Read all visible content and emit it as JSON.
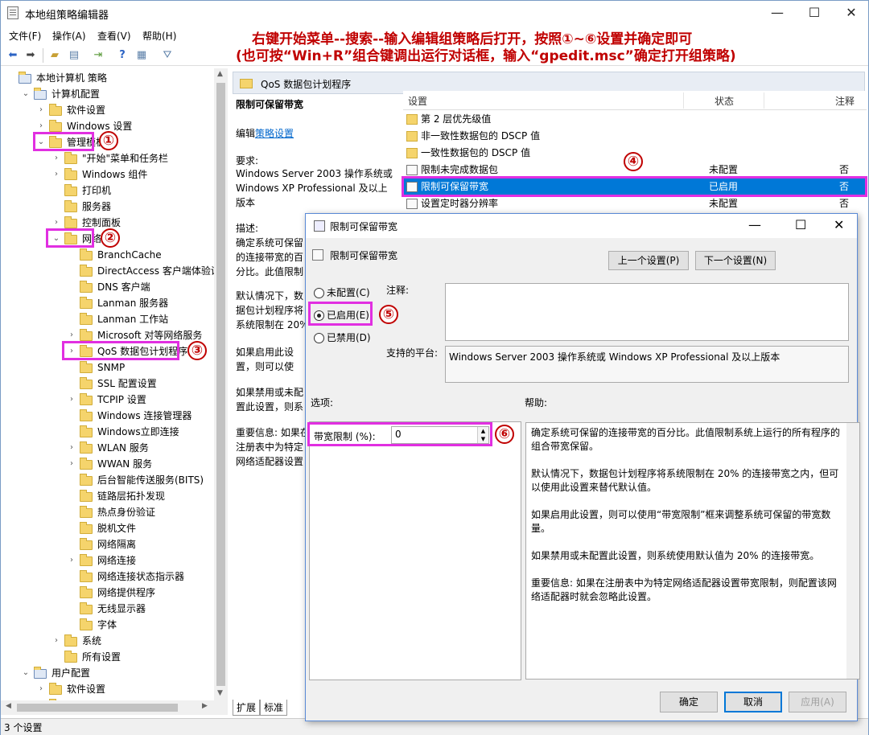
{
  "window": {
    "title": "本地组策略编辑器",
    "min": "—",
    "max": "☐",
    "close": "✕"
  },
  "menu": [
    "文件(F)",
    "操作(A)",
    "查看(V)",
    "帮助(H)"
  ],
  "instruction": {
    "line1": "右键开始菜单--搜索--输入编辑组策略后打开，按照①~⑥设置并确定即可",
    "line2": "(也可按“Win+R”组合键调出运行对话框，输入“gpedit.msc”确定打开组策略)"
  },
  "tree": [
    {
      "label": "本地计算机 策略",
      "indent": 0,
      "exp": "",
      "icon": "computer"
    },
    {
      "label": "计算机配置",
      "indent": 1,
      "exp": "⌄",
      "icon": "computer"
    },
    {
      "label": "软件设置",
      "indent": 2,
      "exp": "›",
      "icon": "folder"
    },
    {
      "label": "Windows 设置",
      "indent": 2,
      "exp": "›",
      "icon": "folder"
    },
    {
      "label": "管理模板",
      "indent": 2,
      "exp": "⌄",
      "icon": "folder"
    },
    {
      "label": "\"开始\"菜单和任务栏",
      "indent": 3,
      "exp": "›",
      "icon": "folder"
    },
    {
      "label": "Windows 组件",
      "indent": 3,
      "exp": "›",
      "icon": "folder"
    },
    {
      "label": "打印机",
      "indent": 3,
      "exp": "",
      "icon": "folder"
    },
    {
      "label": "服务器",
      "indent": 3,
      "exp": "",
      "icon": "folder"
    },
    {
      "label": "控制面板",
      "indent": 3,
      "exp": "›",
      "icon": "folder"
    },
    {
      "label": "网络",
      "indent": 3,
      "exp": "⌄",
      "icon": "folder"
    },
    {
      "label": "BranchCache",
      "indent": 4,
      "exp": "",
      "icon": "folder"
    },
    {
      "label": "DirectAccess 客户端体验设置",
      "indent": 4,
      "exp": "",
      "icon": "folder"
    },
    {
      "label": "DNS 客户端",
      "indent": 4,
      "exp": "",
      "icon": "folder"
    },
    {
      "label": "Lanman 服务器",
      "indent": 4,
      "exp": "",
      "icon": "folder"
    },
    {
      "label": "Lanman 工作站",
      "indent": 4,
      "exp": "",
      "icon": "folder"
    },
    {
      "label": "Microsoft 对等网络服务",
      "indent": 4,
      "exp": "›",
      "icon": "folder"
    },
    {
      "label": "QoS 数据包计划程序",
      "indent": 4,
      "exp": "›",
      "icon": "folder"
    },
    {
      "label": "SNMP",
      "indent": 4,
      "exp": "",
      "icon": "folder"
    },
    {
      "label": "SSL 配置设置",
      "indent": 4,
      "exp": "",
      "icon": "folder"
    },
    {
      "label": "TCPIP 设置",
      "indent": 4,
      "exp": "›",
      "icon": "folder"
    },
    {
      "label": "Windows 连接管理器",
      "indent": 4,
      "exp": "",
      "icon": "folder"
    },
    {
      "label": "Windows立即连接",
      "indent": 4,
      "exp": "",
      "icon": "folder"
    },
    {
      "label": "WLAN 服务",
      "indent": 4,
      "exp": "›",
      "icon": "folder"
    },
    {
      "label": "WWAN 服务",
      "indent": 4,
      "exp": "›",
      "icon": "folder"
    },
    {
      "label": "后台智能传送服务(BITS)",
      "indent": 4,
      "exp": "",
      "icon": "folder"
    },
    {
      "label": "链路层拓扑发现",
      "indent": 4,
      "exp": "",
      "icon": "folder"
    },
    {
      "label": "热点身份验证",
      "indent": 4,
      "exp": "",
      "icon": "folder"
    },
    {
      "label": "脱机文件",
      "indent": 4,
      "exp": "",
      "icon": "folder"
    },
    {
      "label": "网络隔离",
      "indent": 4,
      "exp": "",
      "icon": "folder"
    },
    {
      "label": "网络连接",
      "indent": 4,
      "exp": "›",
      "icon": "folder"
    },
    {
      "label": "网络连接状态指示器",
      "indent": 4,
      "exp": "",
      "icon": "folder"
    },
    {
      "label": "网络提供程序",
      "indent": 4,
      "exp": "",
      "icon": "folder"
    },
    {
      "label": "无线显示器",
      "indent": 4,
      "exp": "",
      "icon": "folder"
    },
    {
      "label": "字体",
      "indent": 4,
      "exp": "",
      "icon": "folder"
    },
    {
      "label": "系统",
      "indent": 3,
      "exp": "›",
      "icon": "folder"
    },
    {
      "label": "所有设置",
      "indent": 3,
      "exp": "",
      "icon": "folder"
    },
    {
      "label": "用户配置",
      "indent": 1,
      "exp": "⌄",
      "icon": "user"
    },
    {
      "label": "软件设置",
      "indent": 2,
      "exp": "›",
      "icon": "folder"
    },
    {
      "label": "Windows 设置",
      "indent": 2,
      "exp": "›",
      "icon": "folder"
    }
  ],
  "right": {
    "header": "QoS 数据包计划程序",
    "desc_title": "限制可保留带宽",
    "edit_prefix": "编辑",
    "edit_link": "策略设置",
    "req_label": "要求:",
    "req_text": "Windows Server 2003 操作系统或 Windows XP Professional 及以上版本",
    "desc_label": "描述:",
    "desc_text": "确定系统可保留的连接带宽的百分比。此值限制系统上运行的所有程序的组合带宽保留。",
    "desc_p2": "默认情况下，数据包计划程序将系统限制在 20% 的连接带宽之内，但可以使用此设置来替代默认值。",
    "desc_p3": "如果启用此设置，则可以使用“带宽限制”框来调整系统可保留的带宽数量。",
    "desc_p4": "如果禁用或未配置此设置，则系统使用默认值为 20% 的连接带宽。",
    "desc_p5": "重要信息: 如果在注册表中为特定网络适配器设置带宽限制，则配置该网络适配器时就会忽略此设置。",
    "col_setting": "设置",
    "col_state": "状态",
    "col_note": "注释",
    "rows": [
      {
        "label": "第 2 层优先级值",
        "state": "",
        "note": "",
        "icon": "folder"
      },
      {
        "label": "非一致性数据包的 DSCP 值",
        "state": "",
        "note": "",
        "icon": "folder"
      },
      {
        "label": "一致性数据包的 DSCP 值",
        "state": "",
        "note": "",
        "icon": "folder"
      },
      {
        "label": "限制未完成数据包",
        "state": "未配置",
        "note": "否",
        "icon": "page"
      },
      {
        "label": "限制可保留带宽",
        "state": "已启用",
        "note": "否",
        "icon": "page"
      },
      {
        "label": "设置定时器分辨率",
        "state": "未配置",
        "note": "否",
        "icon": "page"
      }
    ],
    "tabs": [
      "扩展",
      "标准"
    ]
  },
  "dialog": {
    "title": "限制可保留带宽",
    "subtitle": "限制可保留带宽",
    "prev": "上一个设置(P)",
    "next": "下一个设置(N)",
    "opt_unconfig": "未配置(C)",
    "opt_enabled": "已启用(E)",
    "opt_disabled": "已禁用(D)",
    "note_label": "注释:",
    "platform_label": "支持的平台:",
    "platform_text": "Windows Server 2003 操作系统或 Windows XP Professional 及以上版本",
    "options_label": "选项:",
    "help_label": "帮助:",
    "bw_label": "带宽限制 (%):",
    "bw_value": "0",
    "help": [
      "确定系统可保留的连接带宽的百分比。此值限制系统上运行的所有程序的组合带宽保留。",
      "默认情况下，数据包计划程序将系统限制在 20% 的连接带宽之内，但可以使用此设置来替代默认值。",
      "如果启用此设置，则可以使用“带宽限制”框来调整系统可保留的带宽数量。",
      "如果禁用或未配置此设置，则系统使用默认值为 20% 的连接带宽。",
      "重要信息: 如果在注册表中为特定网络适配器设置带宽限制，则配置该网络适配器时就会忽略此设置。"
    ],
    "ok": "确定",
    "cancel": "取消",
    "apply": "应用(A)"
  },
  "markers": [
    "①",
    "②",
    "③",
    "④",
    "⑤",
    "⑥"
  ],
  "status": "3 个设置",
  "colors": {
    "highlight": "#e12fe1",
    "marker": "#c00000",
    "selected": "#0078d7"
  }
}
